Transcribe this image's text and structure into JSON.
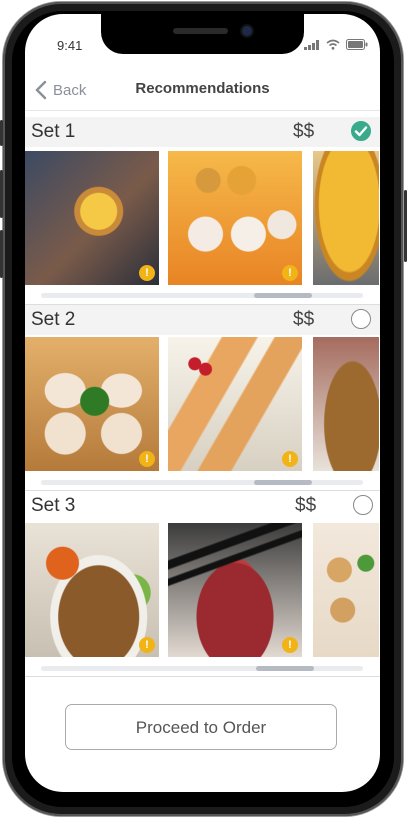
{
  "status": {
    "time": "9:41"
  },
  "nav": {
    "back_label": "Back",
    "title": "Recommendations"
  },
  "sets": [
    {
      "name": "Set 1",
      "price": "$$",
      "selected": true
    },
    {
      "name": "Set 2",
      "price": "$$",
      "selected": false
    },
    {
      "name": "Set 3",
      "price": "$$",
      "selected": false
    }
  ],
  "actions": {
    "proceed_label": "Proceed to Order"
  },
  "colors": {
    "accent": "#3aaa8c",
    "info_badge": "#f1b315"
  },
  "icons": [
    "chevron-left-icon",
    "signal-icon",
    "wifi-icon",
    "battery-icon",
    "check-icon",
    "info-icon"
  ]
}
